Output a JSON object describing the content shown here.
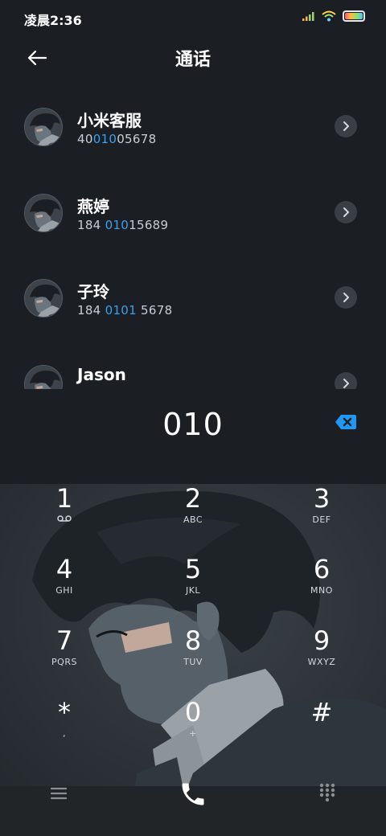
{
  "status": {
    "time": "凌晨2:36"
  },
  "header": {
    "title": "通话",
    "back_icon": "arrow-left-icon"
  },
  "contacts": [
    {
      "name": "小米客服",
      "number_parts": [
        "40",
        "010",
        "05678"
      ]
    },
    {
      "name": "燕婷",
      "number_parts": [
        "184 ",
        "010",
        "15689"
      ]
    },
    {
      "name": "子玲",
      "number_parts": [
        "184 ",
        "0101",
        " 5678"
      ]
    },
    {
      "name": "Jason",
      "number_parts": [
        "",
        "",
        ""
      ]
    }
  ],
  "dial": {
    "value": "010",
    "backspace_icon": "backspace-icon"
  },
  "keypad": [
    {
      "digit": "1",
      "letters": "",
      "icon": "voicemail-icon"
    },
    {
      "digit": "2",
      "letters": "ABC"
    },
    {
      "digit": "3",
      "letters": "DEF"
    },
    {
      "digit": "4",
      "letters": "GHI"
    },
    {
      "digit": "5",
      "letters": "JKL"
    },
    {
      "digit": "6",
      "letters": "MNO"
    },
    {
      "digit": "7",
      "letters": "PQRS"
    },
    {
      "digit": "8",
      "letters": "TUV"
    },
    {
      "digit": "9",
      "letters": "WXYZ"
    },
    {
      "digit": "*",
      "letters": ","
    },
    {
      "digit": "0",
      "letters": "+"
    },
    {
      "digit": "#",
      "letters": ""
    }
  ],
  "bottom": {
    "menu_icon": "menu-icon",
    "call_icon": "phone-icon",
    "dialpad_icon": "dialpad-icon"
  },
  "colors": {
    "background": "#1b1f23",
    "highlight": "#3aa0ee",
    "backspace": "#2196f3"
  }
}
